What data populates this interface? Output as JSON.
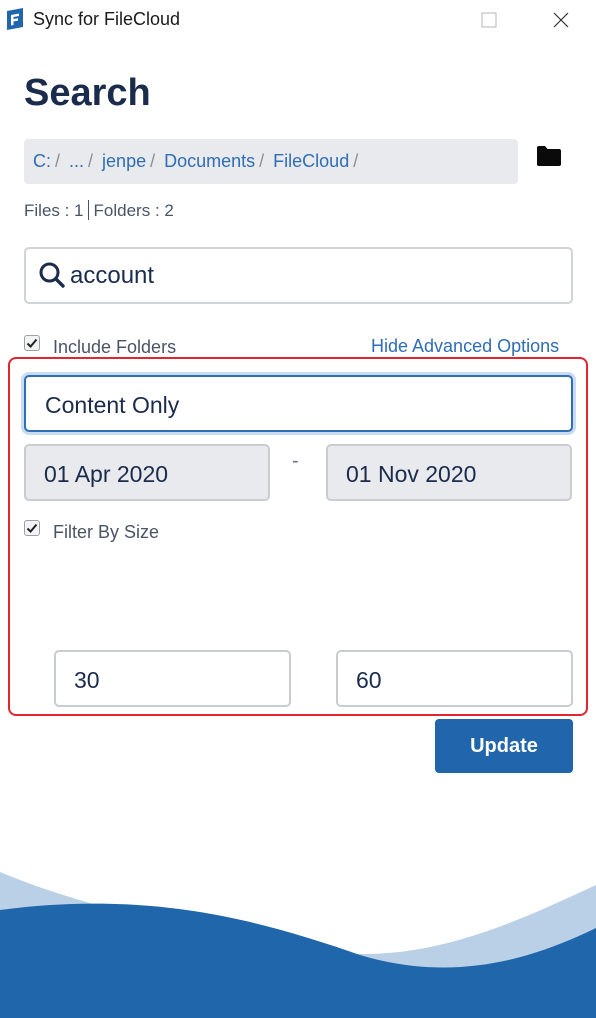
{
  "window": {
    "title": "Sync for FileCloud"
  },
  "page": {
    "title": "Search"
  },
  "breadcrumb": [
    {
      "label": "C:"
    },
    {
      "label": "..."
    },
    {
      "label": "jenpe"
    },
    {
      "label": "Documents"
    },
    {
      "label": "FileCloud"
    }
  ],
  "breadcrumb_separator": "/",
  "counts": {
    "files": "Files : 1",
    "folders": "Folders : 2"
  },
  "search": {
    "value": "account"
  },
  "include_folders": {
    "label": "Include Folders",
    "checked": true
  },
  "advanced": {
    "toggle_label": "Hide Advanced Options",
    "mode": "Content Only",
    "date_from": "01 Apr 2020",
    "date_separator": "-",
    "date_to": "01 Nov 2020",
    "filter_by_size": {
      "label": "Filter By Size",
      "checked": true
    },
    "size_min": "30",
    "size_max": "60"
  },
  "actions": {
    "update_label": "Update"
  },
  "colors": {
    "accent": "#2165ad",
    "link": "#2f6db5",
    "highlight_border": "#e0262f",
    "wave_light": "#b9d0e6",
    "wave_dark": "#1f66ab"
  }
}
